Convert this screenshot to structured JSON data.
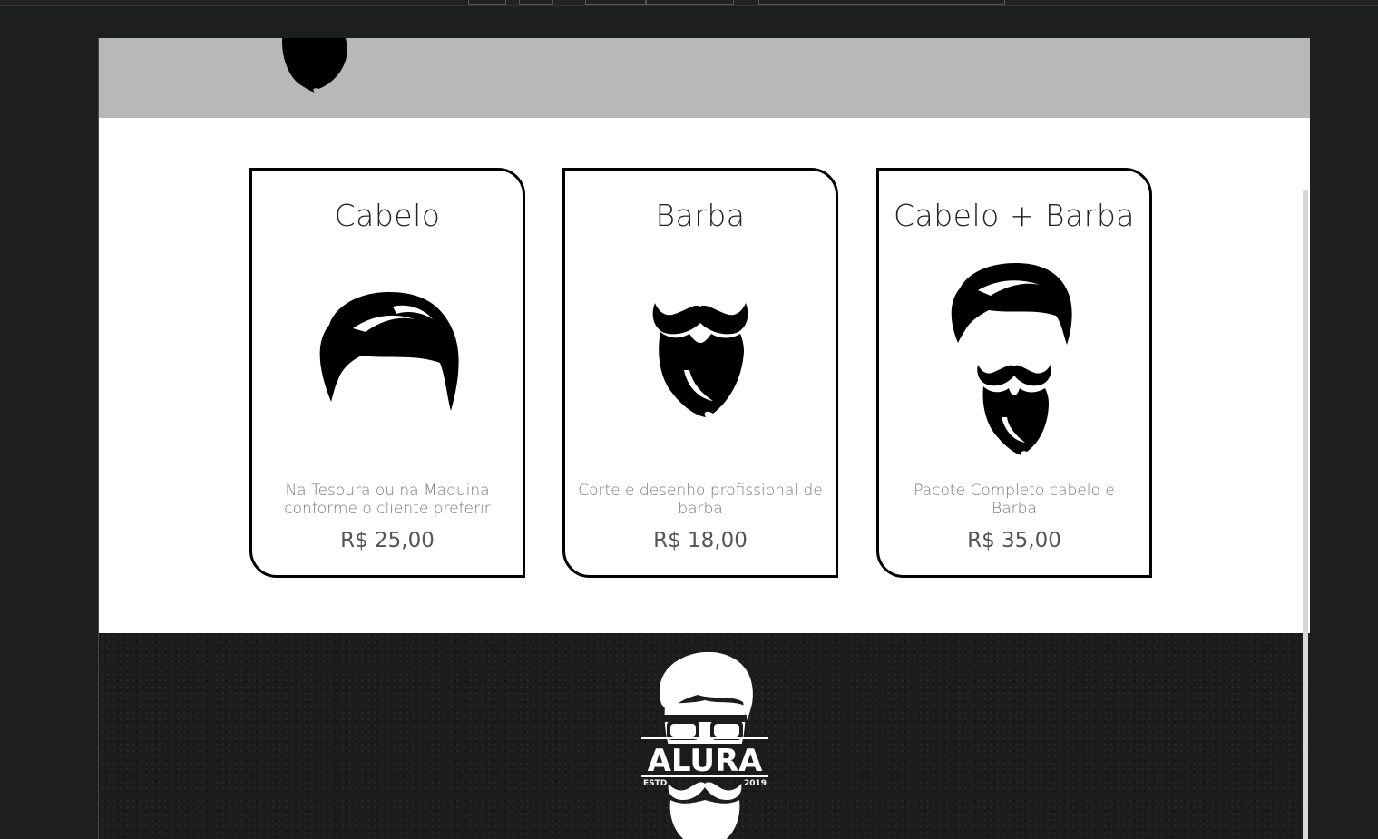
{
  "services": [
    {
      "title": "Cabelo",
      "icon": "hair-icon",
      "description": "Na Tesoura ou na Maquina conforme o cliente preferir",
      "price": "R$ 25,00"
    },
    {
      "title": "Barba",
      "icon": "beard-icon",
      "description": "Corte e desenho profissional de barba",
      "price": "R$ 18,00"
    },
    {
      "title": "Cabelo + Barba",
      "icon": "hair-and-beard-icon",
      "description": "Pacote Completo cabelo e Barba",
      "price": "R$ 35,00"
    }
  ],
  "footer": {
    "logo_name": "ALURA",
    "logo_left": "ESTD",
    "logo_right": "2019"
  },
  "colors": {
    "header_bg": "#b8b8b8",
    "footer_bg": "#1c1c1c",
    "card_border": "#000000"
  }
}
